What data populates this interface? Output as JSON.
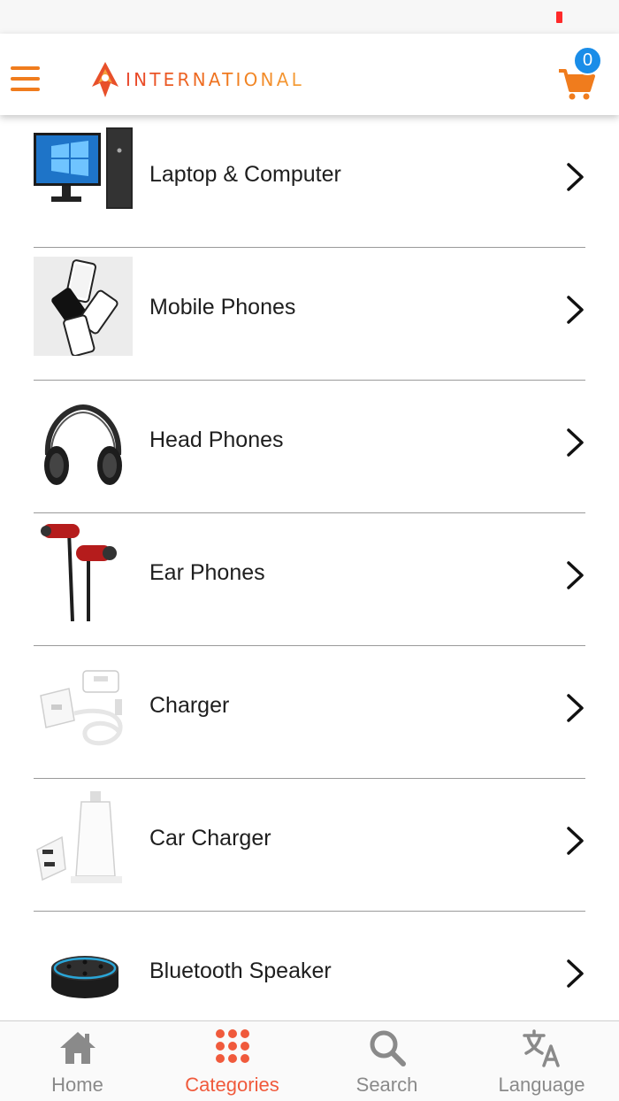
{
  "header": {
    "logo_text": "INTERNATIONAL",
    "cart_count": "0",
    "brand_color": "#f07c1d",
    "badge_color": "#1a8de8"
  },
  "categories": [
    {
      "label": "Laptop & Computer",
      "image": "desktop-computer-image"
    },
    {
      "label": "Mobile Phones",
      "image": "mobile-phones-image"
    },
    {
      "label": "Head Phones",
      "image": "headphones-image"
    },
    {
      "label": "Ear Phones",
      "image": "earphones-image"
    },
    {
      "label": "Charger",
      "image": "charger-image"
    },
    {
      "label": "Car Charger",
      "image": "car-charger-image"
    },
    {
      "label": "Bluetooth Speaker",
      "image": "bluetooth-speaker-image"
    }
  ],
  "tabs": [
    {
      "label": "Home",
      "icon": "home-icon",
      "active": false
    },
    {
      "label": "Categories",
      "icon": "grid-icon",
      "active": true
    },
    {
      "label": "Search",
      "icon": "search-icon",
      "active": false
    },
    {
      "label": "Language",
      "icon": "translate-icon",
      "active": false
    }
  ],
  "colors": {
    "active_tab": "#f05a3c",
    "inactive_tab": "#8a8a8a"
  }
}
